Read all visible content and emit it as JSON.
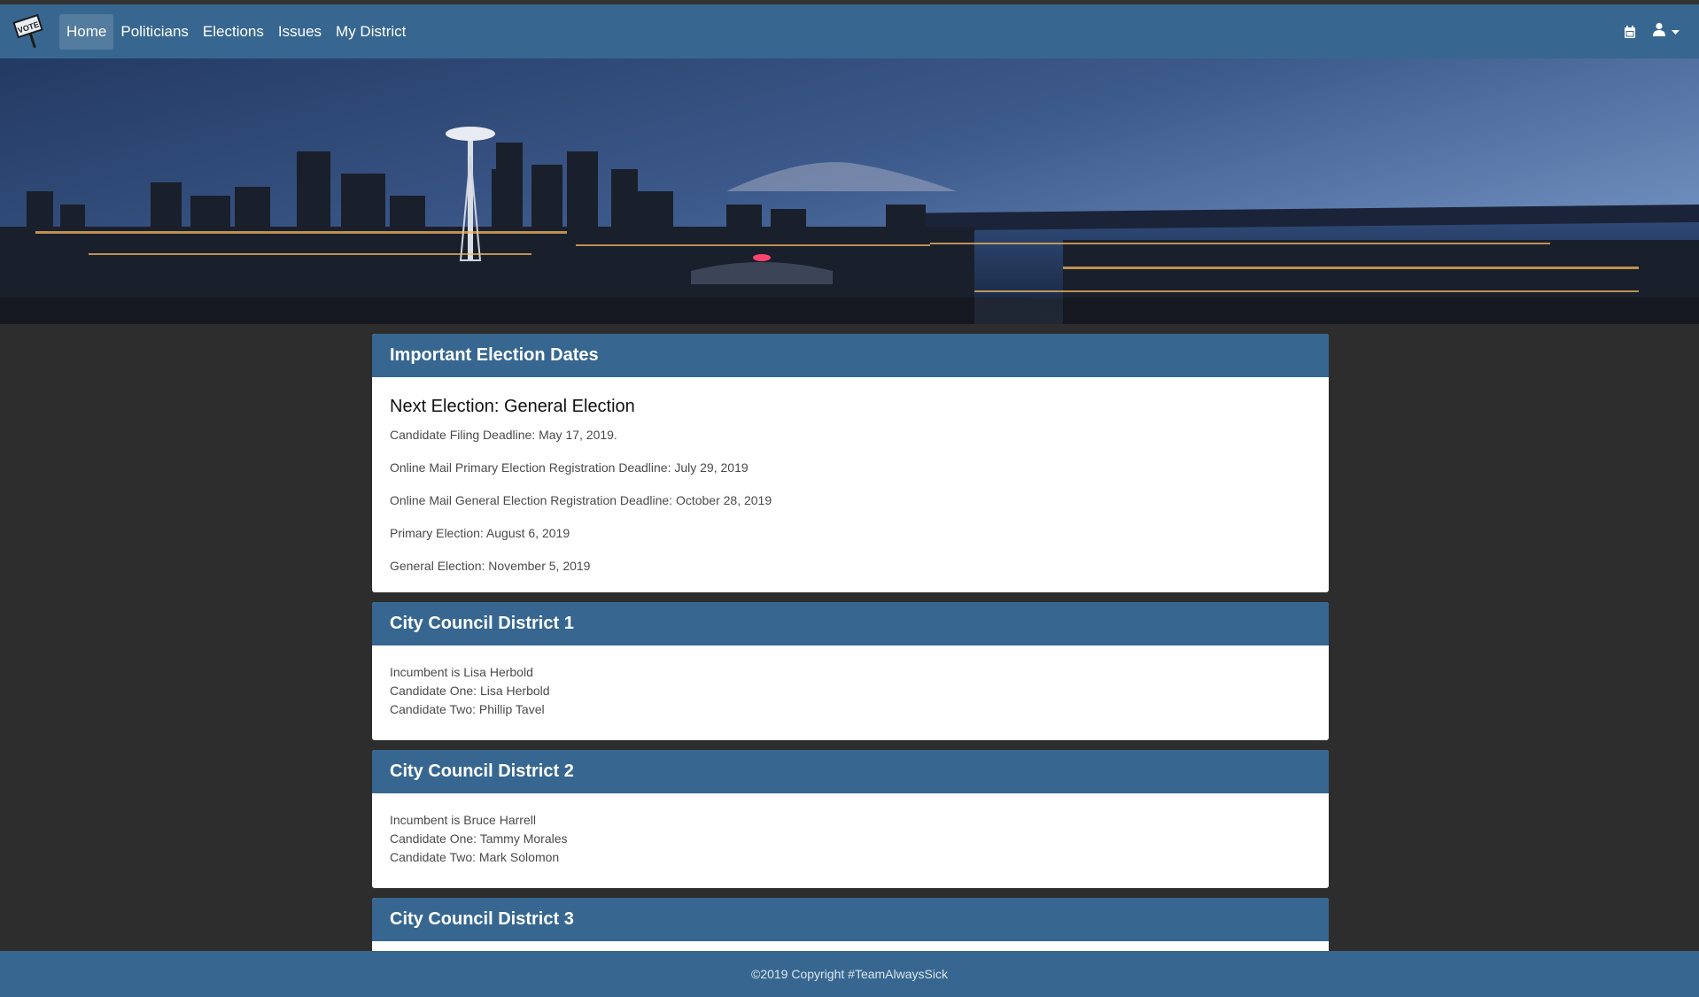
{
  "nav": {
    "brand": "VOTE",
    "links": [
      {
        "label": "Home"
      },
      {
        "label": "Politicians"
      },
      {
        "label": "Elections"
      },
      {
        "label": "Issues"
      },
      {
        "label": "My District"
      }
    ],
    "icons": [
      "calendar-icon",
      "user-icon",
      "caret-down-icon"
    ]
  },
  "dates_card": {
    "title": "Important Election Dates",
    "next_election": "Next Election: General Election",
    "lines": [
      "Candidate Filing Deadline: May 17, 2019.",
      "Online Mail Primary Election Registration Deadline: July 29, 2019",
      "Online Mail General Election Registration Deadline: October 28, 2019",
      "Primary Election: August 6, 2019",
      "General Election: November 5, 2019"
    ]
  },
  "districts": [
    {
      "title": "City Council District 1",
      "incumbent": "Incumbent is Lisa Herbold",
      "candidate_one": "Candidate One: Lisa Herbold",
      "candidate_two": "Candidate Two: Phillip Tavel"
    },
    {
      "title": "City Council District 2",
      "incumbent": "Incumbent is Bruce Harrell",
      "candidate_one": "Candidate One: Tammy Morales",
      "candidate_two": "Candidate Two: Mark Solomon"
    },
    {
      "title": "City Council District 3",
      "incumbent": "",
      "candidate_one": "",
      "candidate_two": ""
    }
  ],
  "footer": {
    "copyright": "©2019 Copyright #TeamAlwaysSick"
  },
  "colors": {
    "primary": "#376790",
    "page_bg": "#2d2d2d",
    "card_bg": "#ffffff"
  }
}
